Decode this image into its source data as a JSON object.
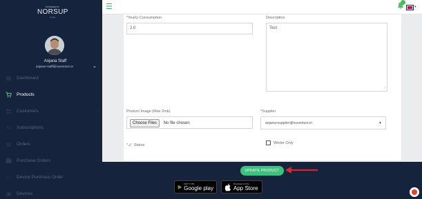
{
  "brand": {
    "tagline": "POWERED BY",
    "name": "NORSUP",
    "subline": "Trusted"
  },
  "user": {
    "name": "Anjana Staff",
    "email": "anjana+staff@nuventure.in"
  },
  "sidebar": {
    "items": [
      {
        "label": "Dashboard",
        "icon": "dashboard-icon",
        "glyph": "▦",
        "active": false,
        "has_arrow": false
      },
      {
        "label": "Products",
        "icon": "cart-icon",
        "glyph": "🛒",
        "active": true,
        "has_arrow": false
      },
      {
        "label": "Customers",
        "icon": "users-icon",
        "glyph": "👥",
        "active": false,
        "has_arrow": true
      },
      {
        "label": "Subscriptions",
        "icon": "subscriptions-icon",
        "glyph": "⇆",
        "active": false,
        "has_arrow": false
      },
      {
        "label": "Orders",
        "icon": "orders-icon",
        "glyph": "▤",
        "active": false,
        "has_arrow": false
      },
      {
        "label": "Purchase Orders",
        "icon": "purchase-orders-icon",
        "glyph": "⛟",
        "active": false,
        "has_arrow": true
      },
      {
        "label": "Device Purchase Order",
        "icon": "device-order-icon",
        "glyph": "▭",
        "active": false,
        "has_arrow": false
      },
      {
        "label": "Devices",
        "icon": "devices-icon",
        "glyph": "▣",
        "active": false,
        "has_arrow": false
      }
    ]
  },
  "form": {
    "yearly_consumption": {
      "label": "Yearly Consumption",
      "required": "*",
      "value": "2.0"
    },
    "description": {
      "label": "Description",
      "value": "Test"
    },
    "product_image": {
      "label": "Product Image (Max 2mb)",
      "button": "Choose Files",
      "status": "No file chosen"
    },
    "supplier": {
      "label": "Supplier",
      "required": "*",
      "value": "anjana+supplier@nuventure.in"
    },
    "status": {
      "label": "Status",
      "required": "*"
    },
    "winter_only": {
      "label": "Winter Only"
    }
  },
  "footer": {
    "update_button": "UPDATE PRODUCT",
    "google_play": {
      "small": "GET IT ON",
      "big": "Google play"
    },
    "app_store": {
      "small": "Download on the",
      "big": "App Store"
    }
  },
  "colors": {
    "sidebar_bg": "#16233c",
    "accent_green": "#3cc27f",
    "annotation_red": "#e0242b"
  }
}
